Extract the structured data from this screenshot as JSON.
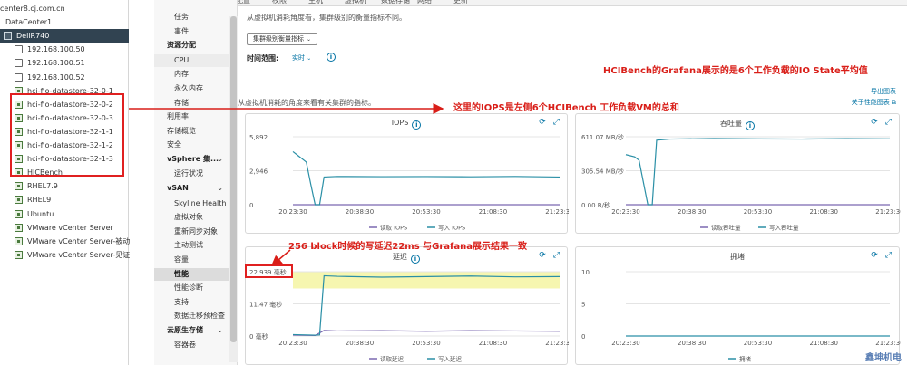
{
  "tree": {
    "items": [
      {
        "label": "center8.cj.com.cn",
        "kind": "vcenter",
        "selected": false
      },
      {
        "label": "DataCenter1",
        "kind": "datacenter",
        "selected": false
      },
      {
        "label": "DellR740",
        "kind": "cluster",
        "selected": true
      },
      {
        "label": "192.168.100.50",
        "kind": "host",
        "selected": false
      },
      {
        "label": "192.168.100.51",
        "kind": "host",
        "selected": false
      },
      {
        "label": "192.168.100.52",
        "kind": "host",
        "selected": false
      },
      {
        "label": "hci-fio-datastore-32-0-1",
        "kind": "vm",
        "selected": false
      },
      {
        "label": "hci-fio-datastore-32-0-2",
        "kind": "vm",
        "selected": false
      },
      {
        "label": "hci-fio-datastore-32-0-3",
        "kind": "vm",
        "selected": false
      },
      {
        "label": "hci-fio-datastore-32-1-1",
        "kind": "vm",
        "selected": false
      },
      {
        "label": "hci-fio-datastore-32-1-2",
        "kind": "vm",
        "selected": false
      },
      {
        "label": "hci-fio-datastore-32-1-3",
        "kind": "vm",
        "selected": false
      },
      {
        "label": "HICBench",
        "kind": "vm",
        "selected": false
      },
      {
        "label": "RHEL7.9",
        "kind": "vm",
        "selected": false
      },
      {
        "label": "RHEL9",
        "kind": "vm",
        "selected": false
      },
      {
        "label": "Ubuntu",
        "kind": "vm",
        "selected": false
      },
      {
        "label": "VMware vCenter Server",
        "kind": "vm",
        "selected": false
      },
      {
        "label": "VMware vCenter Server-被动",
        "kind": "vm",
        "selected": false
      },
      {
        "label": "VMware vCenter Server-见证",
        "kind": "vm",
        "selected": false
      }
    ]
  },
  "menu": {
    "items": [
      {
        "label": "任务",
        "type": "item"
      },
      {
        "label": "事件",
        "type": "item"
      },
      {
        "label": "资源分配",
        "type": "head"
      },
      {
        "label": "CPU",
        "type": "item"
      },
      {
        "label": "内存",
        "type": "item"
      },
      {
        "label": "永久内存",
        "type": "item"
      },
      {
        "label": "存储",
        "type": "item"
      },
      {
        "label": "利用率",
        "type": "flat"
      },
      {
        "label": "存储概览",
        "type": "flat"
      },
      {
        "label": "安全",
        "type": "flat"
      },
      {
        "label": "vSphere 集...",
        "type": "head"
      },
      {
        "label": "运行状况",
        "type": "item"
      },
      {
        "label": "vSAN",
        "type": "head"
      },
      {
        "label": "Skyline Health",
        "type": "item"
      },
      {
        "label": "虚拟对象",
        "type": "item"
      },
      {
        "label": "重新同步对象",
        "type": "item"
      },
      {
        "label": "主动测试",
        "type": "item"
      },
      {
        "label": "容量",
        "type": "item"
      },
      {
        "label": "性能",
        "type": "item"
      },
      {
        "label": "性能诊断",
        "type": "item"
      },
      {
        "label": "支持",
        "type": "item"
      },
      {
        "label": "数据迁移预检查",
        "type": "item"
      },
      {
        "label": "云原生存储",
        "type": "head"
      },
      {
        "label": "容器卷",
        "type": "item"
      }
    ]
  },
  "tabs": [
    "摘要",
    "监控",
    "配置",
    "权限",
    "主机",
    "虚拟机",
    "数据存储",
    "网络",
    "更新"
  ],
  "main": {
    "desc_top": "从虚拟机消耗角度看，集群级别的衡量指标不同。",
    "metric_button": "集群级别衡量指标",
    "range_label": "时间范围:",
    "range_value": "实时",
    "desc_vm": "从虚拟机消耗的角度来看有关集群的指标。",
    "export_link": "导出图表",
    "about_link": "关于性能图表"
  },
  "annotations": {
    "grafana": "HCIBench的Grafana展示的是6个工作负载的IO State平均值",
    "iops_sum": "这里的IOPS是左侧6个HCIBench 工作负载VM的总和",
    "latency": "256 block时候的写延迟22ms 与Grafana展示结果一致"
  },
  "charts": [
    {
      "id": "iops",
      "title": "IOPS",
      "y_ticks": [
        "5,892",
        "2,946",
        "0"
      ],
      "x_ticks": [
        "20:23:30",
        "20:38:30",
        "20:53:30",
        "21:08:30",
        "21:23:30"
      ],
      "legend": [
        "读取 IOPS",
        "写入 IOPS"
      ]
    },
    {
      "id": "throughput",
      "title": "吞吐量",
      "y_ticks": [
        "611.07 MB/秒",
        "305.54 MB/秒",
        "0.00 B/秒"
      ],
      "x_ticks": [
        "20:23:30",
        "20:38:30",
        "20:53:30",
        "21:08:30",
        "21:23:30"
      ],
      "legend": [
        "读取吞吐量",
        "写入吞吐量"
      ]
    },
    {
      "id": "latency",
      "title": "延迟",
      "y_ticks": [
        "22.939 毫秒",
        "11.47 毫秒",
        "0 毫秒"
      ],
      "x_ticks": [
        "20:23:30",
        "20:38:30",
        "20:53:30",
        "21:08:30",
        "21:23:30"
      ],
      "legend": [
        "读取延迟",
        "写入延迟"
      ]
    },
    {
      "id": "congestion",
      "title": "拥堵",
      "y_ticks": [
        "10",
        "5",
        "0"
      ],
      "x_ticks": [
        "20:23:30",
        "20:38:30",
        "20:53:30",
        "21:08:30",
        "21:23:30"
      ],
      "legend": [
        "拥堵"
      ]
    }
  ],
  "chart_data": [
    {
      "type": "line",
      "title": "IOPS",
      "ylim": [
        0,
        5892
      ],
      "x": [
        "20:23:30",
        "20:38:30",
        "20:53:30",
        "21:08:30",
        "21:23:30"
      ],
      "series": [
        {
          "name": "读取 IOPS",
          "color": "#7b68b0",
          "points": [
            [
              0,
              0
            ],
            [
              60,
              0
            ]
          ]
        },
        {
          "name": "写入 IOPS",
          "color": "#2a8fa6",
          "points": [
            [
              0,
              4600
            ],
            [
              1,
              4300
            ],
            [
              3,
              3700
            ],
            [
              4,
              1800
            ],
            [
              5,
              0
            ],
            [
              6,
              0
            ],
            [
              7,
              2400
            ],
            [
              10,
              2450
            ],
            [
              20,
              2430
            ],
            [
              30,
              2440
            ],
            [
              40,
              2420
            ],
            [
              50,
              2450
            ],
            [
              60,
              2400
            ]
          ]
        }
      ]
    },
    {
      "type": "line",
      "title": "吞吐量",
      "ylim": [
        0,
        611.07
      ],
      "x": [
        "20:23:30",
        "20:38:30",
        "20:53:30",
        "21:08:30",
        "21:23:30"
      ],
      "series": [
        {
          "name": "读取吞吐量",
          "color": "#7b68b0",
          "points": [
            [
              0,
              0
            ],
            [
              60,
              0
            ]
          ]
        },
        {
          "name": "写入吞吐量",
          "color": "#2a8fa6",
          "points": [
            [
              0,
              450
            ],
            [
              2,
              430
            ],
            [
              3,
              400
            ],
            [
              4,
              200
            ],
            [
              5,
              0
            ],
            [
              6,
              0
            ],
            [
              7,
              580
            ],
            [
              10,
              590
            ],
            [
              20,
              595
            ],
            [
              30,
              592
            ],
            [
              40,
              590
            ],
            [
              50,
              594
            ],
            [
              60,
              592
            ]
          ]
        }
      ]
    },
    {
      "type": "line",
      "title": "延迟",
      "ylim": [
        0,
        22.939
      ],
      "x": [
        "20:23:30",
        "20:38:30",
        "20:53:30",
        "21:08:30",
        "21:23:30"
      ],
      "series": [
        {
          "name": "读取延迟",
          "color": "#7b68b0",
          "points": [
            [
              0,
              0.3
            ],
            [
              5,
              0.2
            ],
            [
              7,
              2.0
            ],
            [
              10,
              1.8
            ],
            [
              20,
              1.9
            ],
            [
              30,
              1.7
            ],
            [
              40,
              1.9
            ],
            [
              50,
              1.8
            ],
            [
              60,
              1.7
            ]
          ]
        },
        {
          "name": "写入延迟",
          "color": "#2a8fa6",
          "points": [
            [
              0,
              0.5
            ],
            [
              5,
              0.3
            ],
            [
              6,
              0.4
            ],
            [
              7,
              21.5
            ],
            [
              10,
              21.3
            ],
            [
              20,
              21.0
            ],
            [
              30,
              21.2
            ],
            [
              40,
              21.4
            ],
            [
              50,
              21.1
            ],
            [
              60,
              21.2
            ]
          ]
        }
      ]
    },
    {
      "type": "line",
      "title": "拥堵",
      "ylim": [
        0,
        10
      ],
      "x": [
        "20:23:30",
        "20:38:30",
        "20:53:30",
        "21:08:30",
        "21:23:30"
      ],
      "series": [
        {
          "name": "拥堵",
          "color": "#2a8fa6",
          "points": [
            [
              0,
              0
            ],
            [
              60,
              0
            ]
          ]
        }
      ]
    }
  ],
  "brand": "鑫坤机电",
  "colors": {
    "accent": "#0072a3",
    "annotation": "#d91e18",
    "selected": "#314351",
    "latency_band": "#f6f6b0"
  }
}
